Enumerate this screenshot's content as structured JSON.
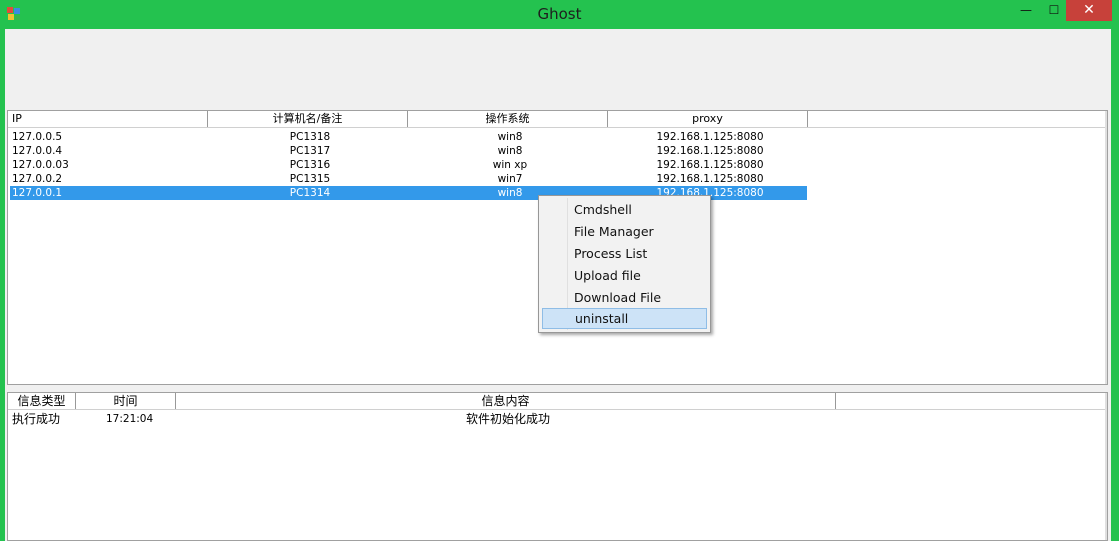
{
  "window": {
    "title": "Ghost",
    "min_glyph": "—",
    "max_glyph": "☐",
    "close_glyph": "✕"
  },
  "hosts": {
    "columns": [
      "IP",
      "计算机名/备注",
      "操作系统",
      "proxy"
    ],
    "rows": [
      {
        "ip": "127.0.0.5",
        "name": "PC1318",
        "os": "win8",
        "proxy": "192.168.1.125:8080"
      },
      {
        "ip": "127.0.0.4",
        "name": "PC1317",
        "os": "win8",
        "proxy": "192.168.1.125:8080"
      },
      {
        "ip": "127.0.0.03",
        "name": "PC1316",
        "os": "win xp",
        "proxy": "192.168.1.125:8080"
      },
      {
        "ip": "127.0.0.2",
        "name": "PC1315",
        "os": "win7",
        "proxy": "192.168.1.125:8080"
      },
      {
        "ip": "127.0.0.1",
        "name": "PC1314",
        "os": "win8",
        "proxy": "192.168.1.125:8080"
      }
    ],
    "selected_index": 4
  },
  "context_menu": {
    "items": [
      "Cmdshell",
      "File Manager",
      "Process List",
      "Upload file",
      "Download File",
      "uninstall"
    ],
    "hover_index": 5
  },
  "log": {
    "columns": [
      "信息类型",
      "时间",
      "信息内容"
    ],
    "rows": [
      {
        "type": "执行成功",
        "time": "17:21:04",
        "content": "软件初始化成功"
      }
    ]
  },
  "colors": {
    "title_bar": "#24c24f",
    "selection": "#3399ea",
    "close": "#c7413a",
    "menu_hover": "#cde3f7"
  }
}
